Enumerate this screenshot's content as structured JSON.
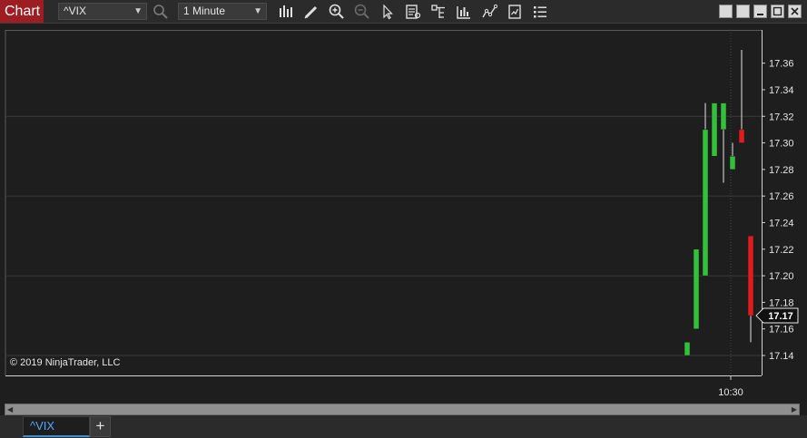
{
  "toolbar": {
    "title": "Chart",
    "instrument": "^VIX",
    "interval": "1 Minute",
    "icons": [
      "search-icon",
      "bars-type-icon",
      "pencil-draw-icon",
      "zoom-in-icon",
      "zoom-out-icon",
      "pointer-icon",
      "data-box-icon",
      "properties-icon",
      "indicators-icon",
      "strategies-icon",
      "chart-trader-icon",
      "list-icon"
    ],
    "window_icons": [
      "tile-icon",
      "tile-icon-2",
      "minimize-icon",
      "maximize-icon",
      "close-icon"
    ]
  },
  "chart": {
    "copyright": "© 2019 NinjaTrader, LLC",
    "price_marker": "17.17"
  },
  "chart_data": {
    "type": "candlestick",
    "y_ticks": [
      "17.36",
      "17.34",
      "17.32",
      "17.30",
      "17.28",
      "17.26",
      "17.24",
      "17.22",
      "17.20",
      "17.18",
      "17.16",
      "17.14"
    ],
    "x_ticks": [
      "10:30"
    ],
    "ylim": [
      17.125,
      17.385
    ],
    "up_color": "#33c13b",
    "down_color": "#e01c1c",
    "candles": [
      {
        "open": 17.14,
        "high": 17.15,
        "low": 17.14,
        "close": 17.15
      },
      {
        "open": 17.16,
        "high": 17.22,
        "low": 17.16,
        "close": 17.22
      },
      {
        "open": 17.2,
        "high": 17.33,
        "low": 17.2,
        "close": 17.31
      },
      {
        "open": 17.29,
        "high": 17.33,
        "low": 17.29,
        "close": 17.33
      },
      {
        "open": 17.31,
        "high": 17.33,
        "low": 17.27,
        "close": 17.33
      },
      {
        "open": 17.28,
        "high": 17.3,
        "low": 17.28,
        "close": 17.29
      },
      {
        "open": 17.31,
        "high": 17.37,
        "low": 17.3,
        "close": 17.3
      },
      {
        "open": 17.23,
        "high": 17.23,
        "low": 17.15,
        "close": 17.17
      }
    ]
  },
  "tabs": {
    "active": "^VIX",
    "add": "+"
  }
}
